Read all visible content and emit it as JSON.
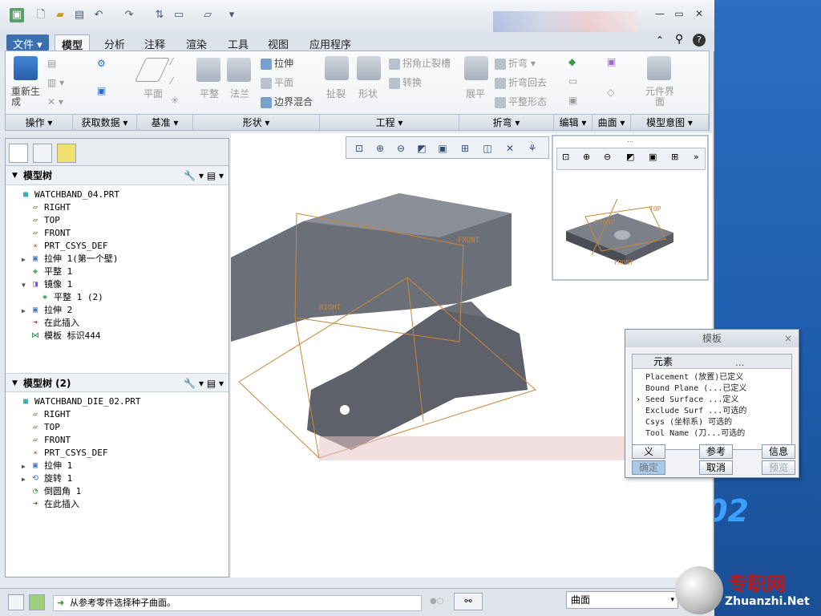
{
  "colors": {
    "accent": "#3d6fae",
    "sketch": "#c8873a",
    "model": "#6b6f78"
  },
  "ribbon": {
    "tabs": [
      "文件 ▾",
      "模型",
      "分析",
      "注释",
      "渲染",
      "工具",
      "视图",
      "应用程序"
    ],
    "groups": [
      "操作 ▾",
      "获取数据 ▾",
      "基准 ▾",
      "形状 ▾",
      "工程 ▾",
      "折弯 ▾",
      "编辑 ▾",
      "曲面 ▾",
      "模型意图 ▾"
    ],
    "buttons": {
      "regen": "重新生成",
      "plane": "平面",
      "flat": "平整",
      "flange": "法兰",
      "extrude": "拉伸",
      "plane2": "平面",
      "boundary_blend": "边界混合",
      "rip": "扯裂",
      "form": "形状",
      "corner_relief": "拐角止裂槽",
      "convert": "转换",
      "unbend": "展平",
      "bend": "折弯",
      "bend_back": "折弯回去",
      "flat_state": "平整形态",
      "component_interface": "元件界面"
    }
  },
  "tree1": {
    "header": "模型树",
    "items": [
      {
        "label": "WATCHBAND_04.PRT",
        "icon": "part-icon"
      },
      {
        "label": "RIGHT",
        "icon": "datum-plane-icon"
      },
      {
        "label": "TOP",
        "icon": "datum-plane-icon"
      },
      {
        "label": "FRONT",
        "icon": "datum-plane-icon"
      },
      {
        "label": "PRT_CSYS_DEF",
        "icon": "csys-icon"
      },
      {
        "label": "拉伸 1(第一个壁)",
        "icon": "extrude-icon",
        "exp": "▶"
      },
      {
        "label": "平整 1",
        "icon": "flat-wall-icon"
      },
      {
        "label": "镜像 1",
        "icon": "mirror-icon",
        "exp": "▼"
      },
      {
        "label": "平整 1 (2)",
        "icon": "flat-wall-icon"
      },
      {
        "label": "拉伸 2",
        "icon": "extrude-icon",
        "exp": "▶"
      },
      {
        "label": "在此插入",
        "icon": "insert-here-icon"
      },
      {
        "label": "模板 标识444",
        "icon": "punch-icon"
      }
    ]
  },
  "tree2": {
    "header": "模型树 (2)",
    "items": [
      {
        "label": "WATCHBAND_DIE_02.PRT",
        "icon": "part-icon"
      },
      {
        "label": "RIGHT",
        "icon": "datum-plane-icon"
      },
      {
        "label": "TOP",
        "icon": "datum-plane-icon"
      },
      {
        "label": "FRONT",
        "icon": "datum-plane-icon"
      },
      {
        "label": "PRT_CSYS_DEF",
        "icon": "csys-icon"
      },
      {
        "label": "拉伸 1",
        "icon": "extrude-icon",
        "exp": "▶"
      },
      {
        "label": "旋转 1",
        "icon": "revolve-icon",
        "exp": "▶"
      },
      {
        "label": "倒圆角 1",
        "icon": "round-icon"
      },
      {
        "label": "在此插入",
        "icon": "insert-here-icon"
      }
    ]
  },
  "viewport": {
    "labels": {
      "front": "FRONT",
      "right": "RIGHT"
    },
    "mini_labels": {
      "top": "TOP",
      "right": "RIGHT",
      "front": "FRONT"
    }
  },
  "dialog": {
    "title": "模板",
    "col": "元素",
    "col2": "...",
    "rows": [
      {
        "text": "Placement (放置)已定义",
        "cur": false
      },
      {
        "text": "Bound Plane (...已定义",
        "cur": false
      },
      {
        "text": "Seed Surface ...定义",
        "cur": true
      },
      {
        "text": "Exclude Surf ...可选的",
        "cur": false
      },
      {
        "text": "Csys (坐标系)  可选的",
        "cur": false
      },
      {
        "text": "Tool Name (刀...可选的",
        "cur": false
      }
    ],
    "buttons": {
      "define": "义",
      "refs": "参考",
      "info": "信息",
      "ok": "确定",
      "cancel": "取消",
      "preview": "预览"
    }
  },
  "status": {
    "message": "从参考零件选择种子曲面。",
    "filter": "曲面"
  },
  "watermark": {
    "cn": "专职网",
    "url": "Zhuanzhi.Net"
  },
  "desk_text": "02"
}
